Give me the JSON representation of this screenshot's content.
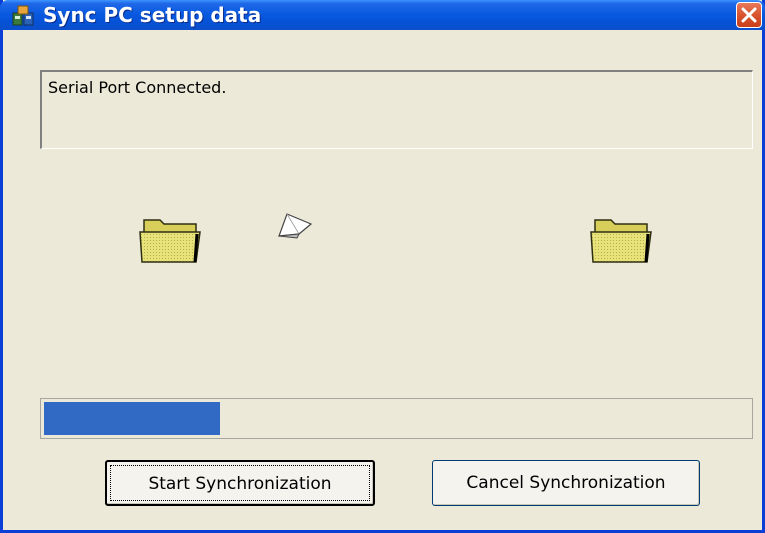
{
  "window": {
    "title": "Sync PC setup data"
  },
  "status": {
    "message": "Serial Port Connected."
  },
  "progress": {
    "fraction": 0.25,
    "color": "#316ac5"
  },
  "buttons": {
    "start_label": "Start Synchronization",
    "cancel_label": "Cancel Synchronization"
  },
  "icons": {
    "app": "sync-app-icon",
    "close": "close-icon",
    "source_folder": "folder-icon",
    "destination_folder": "folder-icon",
    "transfer": "flying-document-icon"
  },
  "colors": {
    "titlebar": "#0a5ae0",
    "close_button": "#d9532f",
    "dialog_background": "#ece9d8",
    "folder": "#e7e27a"
  }
}
